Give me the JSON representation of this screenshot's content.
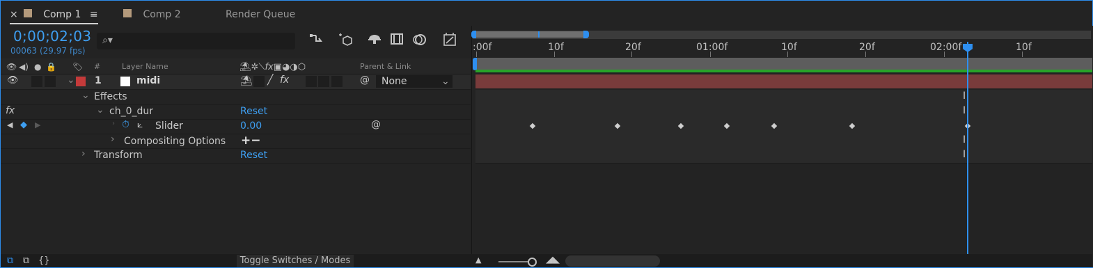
{
  "tabs": [
    {
      "close": "×",
      "label": "Comp 1",
      "menu": "≡"
    },
    {
      "label": "Comp 2"
    },
    {
      "label": "Render Queue"
    }
  ],
  "timecode": "0;00;02;03",
  "frame_info": "00063 (29.97 fps)",
  "search": {
    "placeholder": ""
  },
  "column_headers": {
    "number": "#",
    "layer_name": "Layer Name",
    "parent_link": "Parent & Link"
  },
  "layer": {
    "index": "1",
    "name": "midi",
    "parent": "None"
  },
  "properties": {
    "effects": "Effects",
    "effect_name": "ch_0_dur",
    "effect_reset": "Reset",
    "slider": "Slider",
    "slider_value": "0.00",
    "compositing": "Compositing Options",
    "compositing_ops": "+−",
    "transform": "Transform",
    "transform_reset": "Reset",
    "fx": "fx"
  },
  "ruler_labels": [
    ":00f",
    "10f",
    "20f",
    "01:00f",
    "10f",
    "20f",
    "02:00f",
    "10f"
  ],
  "bottom": {
    "toggle_label": "Toggle Switches / Modes"
  },
  "colors": {
    "accent": "#2e8ff0",
    "layer_bar": "#793b3b",
    "label_red": "#c43a3a",
    "work_green": "#29a329"
  }
}
